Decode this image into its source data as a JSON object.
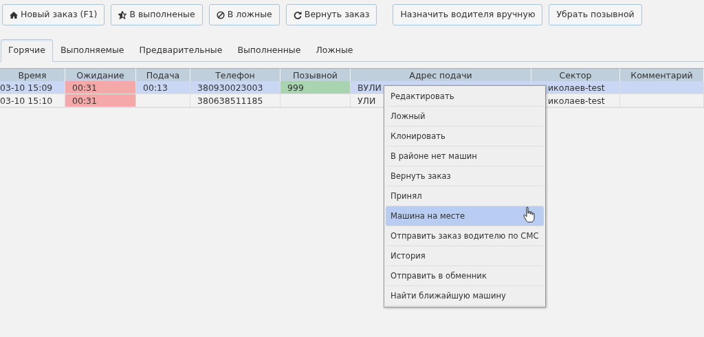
{
  "toolbar": [
    {
      "label": "Новый заказ (F1)"
    },
    {
      "label": "В выполненые"
    },
    {
      "label": "В ложные"
    },
    {
      "label": "Вернуть заказ"
    },
    {
      "label": "Назначить водителя вручную"
    },
    {
      "label": "Убрать позывной"
    }
  ],
  "tabs": [
    {
      "label": "Горячие",
      "selected": true
    },
    {
      "label": "Выполняемые",
      "selected": false
    },
    {
      "label": "Предварительные",
      "selected": false
    },
    {
      "label": "Выполненные",
      "selected": false
    },
    {
      "label": "Ложные",
      "selected": false
    }
  ],
  "table": {
    "columns": [
      "Время",
      "Ожидание",
      "Подача",
      "Телефон",
      "Позывной",
      "Адрес подачи",
      "Сектор",
      "Комментарий"
    ],
    "rows": [
      {
        "selected": true,
        "cells": [
          {
            "text": "03-10 15:09"
          },
          {
            "text": "00:31",
            "color": "#f4a9a8"
          },
          {
            "text": "00:13"
          },
          {
            "text": "380930023003"
          },
          {
            "text": "999",
            "color": "#a9d4b0"
          },
          {
            "text": "ВУЛИ"
          },
          {
            "text": "иколаев-test"
          },
          {
            "text": ""
          }
        ]
      },
      {
        "selected": false,
        "cells": [
          {
            "text": "03-10 15:10"
          },
          {
            "text": "00:31",
            "color": "#f4a9a8"
          },
          {
            "text": ""
          },
          {
            "text": "380638511185"
          },
          {
            "text": ""
          },
          {
            "text": "УЛИ"
          },
          {
            "text": "иколаев-test"
          },
          {
            "text": ""
          }
        ]
      }
    ]
  },
  "context_menu": {
    "items": [
      {
        "label": "Редактировать",
        "selected": false
      },
      {
        "label": "Ложный",
        "selected": false
      },
      {
        "label": "Клонировать",
        "selected": false
      },
      {
        "label": "В районе нет машин",
        "selected": false
      },
      {
        "label": "Вернуть заказ",
        "selected": false
      },
      {
        "label": "Принял",
        "selected": false
      },
      {
        "label": "Машина на месте",
        "selected": true
      },
      {
        "label": "Отправить заказ водителю по СМС",
        "selected": false
      },
      {
        "label": "История",
        "selected": false
      },
      {
        "label": "Отправить в обменник",
        "selected": false
      },
      {
        "label": "Найти ближайшую машину",
        "selected": false
      }
    ]
  }
}
